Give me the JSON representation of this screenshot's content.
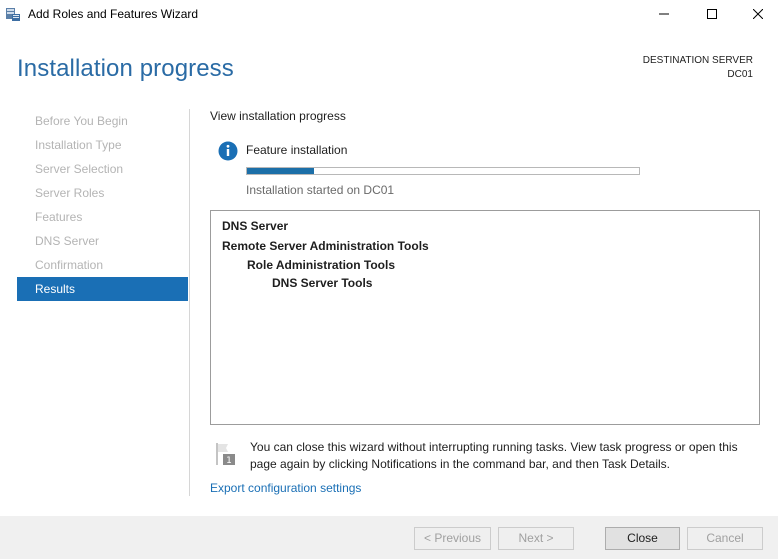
{
  "window": {
    "title": "Add Roles and Features Wizard",
    "minimize_icon": "minimize-icon",
    "maximize_icon": "maximize-icon",
    "close_icon": "close-icon"
  },
  "header": {
    "page_title": "Installation progress",
    "destination_label": "DESTINATION SERVER",
    "destination_value": "DC01"
  },
  "sidebar": {
    "items": [
      {
        "label": "Before You Begin",
        "active": false
      },
      {
        "label": "Installation Type",
        "active": false
      },
      {
        "label": "Server Selection",
        "active": false
      },
      {
        "label": "Server Roles",
        "active": false
      },
      {
        "label": "Features",
        "active": false
      },
      {
        "label": "DNS Server",
        "active": false
      },
      {
        "label": "Confirmation",
        "active": false
      },
      {
        "label": "Results",
        "active": true
      }
    ]
  },
  "main": {
    "section_label": "View installation progress",
    "feature_title": "Feature installation",
    "progress_fraction": 0.17,
    "install_status": "Installation started on DC01",
    "features": [
      {
        "label": "DNS Server",
        "level": 0
      },
      {
        "label": "Remote Server Administration Tools",
        "level": 0
      },
      {
        "label": "Role Administration Tools",
        "level": 1
      },
      {
        "label": "DNS Server Tools",
        "level": 2
      }
    ],
    "notice_text": "You can close this wizard without interrupting running tasks. View task progress or open this page again by clicking Notifications in the command bar, and then Task Details.",
    "export_link": "Export configuration settings"
  },
  "footer": {
    "previous_label": "< Previous",
    "next_label": "Next >",
    "close_label": "Close",
    "cancel_label": "Cancel"
  },
  "colors": {
    "accent": "#1a6fb5",
    "title_blue": "#2a6ba5",
    "progress_fill": "#1c6fa8"
  }
}
